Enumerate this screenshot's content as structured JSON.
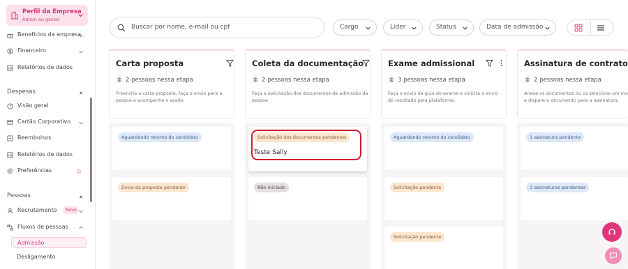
{
  "sidebar": {
    "profile": {
      "title": "Perfil da Empresa",
      "subtitle": "Admin ou gestor",
      "icon": "building-icon"
    },
    "items_top": [
      {
        "label": "Benefícios da empresa",
        "icon": "gift-icon",
        "chevron": true
      },
      {
        "label": "Financeiro",
        "icon": "dollar-icon",
        "chevron": true
      },
      {
        "label": "Relatórios de dados",
        "icon": "report-icon",
        "chevron": false
      }
    ],
    "section_despesas": "Despesas",
    "items_despesas": [
      {
        "label": "Visão geral",
        "icon": "overview-icon"
      },
      {
        "label": "Cartão Corporativo",
        "icon": "card-icon"
      },
      {
        "label": "Reembolsos",
        "icon": "refund-icon"
      },
      {
        "label": "Relatórios de dados",
        "icon": "report-icon"
      },
      {
        "label": "Preferências",
        "icon": "settings-icon"
      }
    ],
    "section_pessoas": "Pessoas",
    "items_pessoas": [
      {
        "label": "Recrutamento",
        "icon": "people-icon",
        "badge": "Novo"
      },
      {
        "label": "Fluxos de pessoas",
        "icon": "flow-icon"
      }
    ],
    "subitems": [
      {
        "label": "Admissão",
        "active": true
      },
      {
        "label": "Desligamento",
        "active": false
      }
    ]
  },
  "search": {
    "placeholder": "Buscar por nome, e-mail ou cpf"
  },
  "filters": [
    "Cargo",
    "Líder",
    "Status",
    "Data de admissão"
  ],
  "columns": [
    {
      "title": "Carta proposta",
      "count": "2 pessoas nessa etapa",
      "description": "Preencha a carta proposta, faça o envio para a pessoa e acompanhe o aceite",
      "cards": [
        {
          "tag": "Aguardando retorno do candidato",
          "tag_color": "blue",
          "name": ""
        },
        {
          "tag": "Envio da proposta pendente",
          "tag_color": "peach",
          "name": ""
        }
      ]
    },
    {
      "title": "Coleta da documentação",
      "count": "2 pessoas nessa etapa",
      "description": "Faça a solicitação dos documentos de admissão da pessoa",
      "cards": [
        {
          "tag": "Solicitação dos documentos pendentes",
          "tag_color": "peach",
          "name": "Teste Sally"
        },
        {
          "tag": "Não iniciado",
          "tag_color": "gray",
          "name": ""
        }
      ]
    },
    {
      "title": "Exame admissional",
      "count": "3 pessoas nessa etapa",
      "description": "Faça o envio da guia do exame e solicite o envio do resultado pela plataforma.",
      "cards": [
        {
          "tag": "Aguardando retorno do candidato",
          "tag_color": "blue",
          "name": ""
        },
        {
          "tag": "Solicitação pendente",
          "tag_color": "peach",
          "name": ""
        },
        {
          "tag": "Solicitação pendente",
          "tag_color": "peach",
          "name": ""
        }
      ]
    },
    {
      "title": "Assinatura de contrato",
      "count": "2 pessoas nessa etapa",
      "description": "Anexe os documentos ou os selecione um modelo e dispare o documento para a assinatura.",
      "cards": [
        {
          "tag": "1 assinatura pendente",
          "tag_color": "blue",
          "name": ""
        },
        {
          "tag": "3 assinaturas pendentes",
          "tag_color": "blue",
          "name": ""
        }
      ]
    }
  ],
  "colors": {
    "brand": "#e0357c",
    "highlight": "#d21c2f"
  }
}
